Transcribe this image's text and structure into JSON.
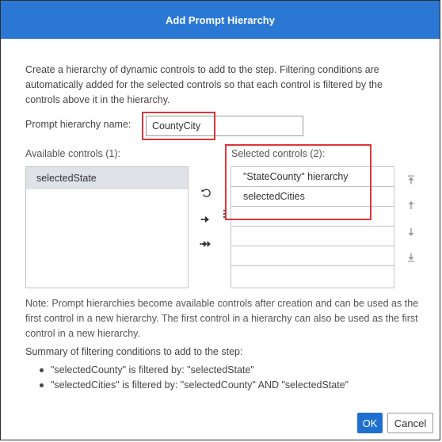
{
  "dialog": {
    "title": "Add Prompt Hierarchy",
    "description": "Create a hierarchy of dynamic controls to add to the step. Filtering conditions are automatically added for the selected controls so that each control is filtered by the controls above it in the hierarchy.",
    "name_label": "Prompt hierarchy name:",
    "name_value": "CountyCity",
    "available_label": "Available controls (1):",
    "available_items": [
      "selectedState"
    ],
    "selected_label": "Selected controls (2):",
    "selected_items": [
      "\"StateCounty\" hierarchy",
      "selectedCities",
      "",
      "",
      "",
      ""
    ],
    "note": "Note: Prompt hierarchies become available controls after creation and can be used as the first control in a new hierarchy. The first control in a hierarchy can also be used as the first control in a new hierarchy.",
    "summary_title": "Summary of filtering conditions to add to the step:",
    "summary_items": [
      "\"selectedCounty\" is filtered by: \"selectedState\"",
      "\"selectedCities\" is filtered by: \"selectedCounty\" AND \"selectedState\""
    ],
    "ok_label": "OK",
    "cancel_label": "Cancel"
  },
  "icons": {
    "reset": "undo-icon",
    "add": "move-right-icon",
    "add_all": "move-all-right-icon",
    "move_top": "move-to-top-icon",
    "move_up": "move-up-icon",
    "move_down": "move-down-icon",
    "move_bottom": "move-to-bottom-icon"
  },
  "colors": {
    "title_bar": "#2b78d4",
    "highlight": "#e0353b",
    "ok_button": "#1f6fd0",
    "selected_item_bg": "#dfe2e7"
  }
}
